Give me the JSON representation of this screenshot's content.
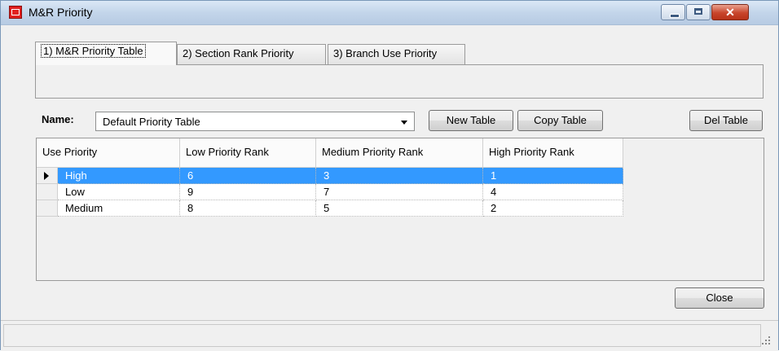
{
  "window": {
    "title": "M&R Priority"
  },
  "tabs": [
    {
      "label": "1) M&R Priority Table"
    },
    {
      "label": "2) Section Rank Priority"
    },
    {
      "label": "3) Branch Use Priority"
    }
  ],
  "name_field": {
    "label": "Name:",
    "value": "Default Priority Table"
  },
  "buttons": {
    "new_table": "New Table",
    "copy_table": "Copy Table",
    "del_table": "Del Table",
    "close": "Close"
  },
  "grid": {
    "columns": [
      "Use Priority",
      "Low Priority Rank",
      "Medium Priority Rank",
      "High Priority Rank"
    ],
    "rows": [
      [
        "High",
        "6",
        "3",
        "1"
      ],
      [
        "Low",
        "9",
        "7",
        "4"
      ],
      [
        "Medium",
        "8",
        "5",
        "2"
      ]
    ],
    "selected_row": 0
  },
  "colors": {
    "selection": "#3399ff",
    "title_bar": "#c3d5ea",
    "close_button": "#c8452b"
  },
  "icons": [
    "app-icon",
    "minimize-icon",
    "maximize-icon",
    "close-icon",
    "row-pointer-icon",
    "dropdown-arrow-icon",
    "resize-grip-icon"
  ]
}
